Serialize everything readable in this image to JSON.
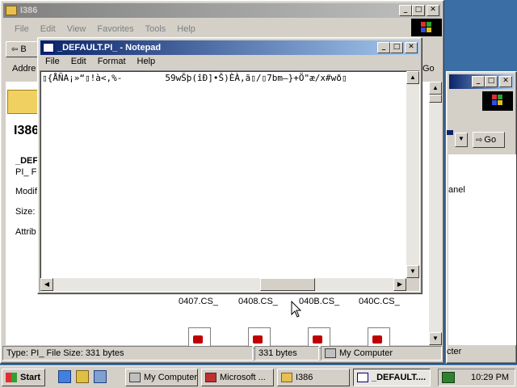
{
  "explorer_back": {
    "title": "I386",
    "menu": [
      "File",
      "Edit",
      "View",
      "Favorites",
      "Tools",
      "Help"
    ],
    "toolbar": {
      "back": "B",
      "address_label": "Addre",
      "go": "Go"
    },
    "folder_title": "I386",
    "details": {
      "name": "_DEF",
      "type": "PI_ Fi",
      "modified": "Modif",
      "size": "Size:",
      "attributes": "Attrib"
    },
    "files": [
      "0407.CS_",
      "0408.CS_",
      "040B.CS_",
      "040C.CS_"
    ],
    "status_left": "Type: PI_ File Size: 331 bytes",
    "status_mid": "331 bytes",
    "status_zone": "My Computer"
  },
  "right_window": {
    "go": "Go",
    "panel_text": "anel",
    "status_text": "cter"
  },
  "notepad": {
    "title": "_DEFAULT.PI_ - Notepad",
    "menu": [
      "File",
      "Edit",
      "Format",
      "Help"
    ],
    "content_line": "▯{ÅÑA¡»“▯!à<,%-        59wŠþ(îÐ]•Š)ÈÀ,ã▯/▯7bm–}+Ö\"æ/x#wð▯"
  },
  "taskbar": {
    "start": "Start",
    "buttons": [
      "My Computer",
      "Microsoft ...",
      "I386",
      "_DEFAULT...."
    ],
    "clock": "10:29 PM"
  },
  "colors": {
    "desktop": "#3a6ea5",
    "active_title": "#0a246a",
    "face": "#d4d0c8"
  }
}
